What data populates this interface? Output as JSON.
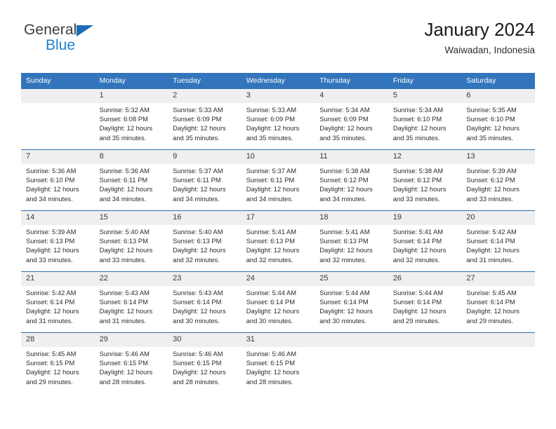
{
  "brand": {
    "name_part1": "General",
    "name_part2": "Blue",
    "triangle_icon": "brand-triangle-icon",
    "color_dark": "#3c3c3c",
    "color_blue": "#2081cf"
  },
  "header": {
    "title": "January 2024",
    "subtitle": "Waiwadan, Indonesia",
    "accent_color": "#3275bc"
  },
  "calendar": {
    "weekday_headers": [
      "Sunday",
      "Monday",
      "Tuesday",
      "Wednesday",
      "Thursday",
      "Friday",
      "Saturday"
    ],
    "header_bg": "#3275bc",
    "header_text_color": "#ffffff",
    "daynum_bg": "#efefef",
    "row_border_color": "#2f6da8",
    "labels": {
      "sunrise": "Sunrise:",
      "sunset": "Sunset:",
      "daylight": "Daylight:"
    },
    "weeks": [
      [
        {
          "day": "",
          "sunrise": "",
          "sunset": "",
          "daylight_a": "",
          "daylight_b": ""
        },
        {
          "day": "1",
          "sunrise": "Sunrise: 5:32 AM",
          "sunset": "Sunset: 6:08 PM",
          "daylight_a": "Daylight: 12 hours",
          "daylight_b": "and 35 minutes."
        },
        {
          "day": "2",
          "sunrise": "Sunrise: 5:33 AM",
          "sunset": "Sunset: 6:09 PM",
          "daylight_a": "Daylight: 12 hours",
          "daylight_b": "and 35 minutes."
        },
        {
          "day": "3",
          "sunrise": "Sunrise: 5:33 AM",
          "sunset": "Sunset: 6:09 PM",
          "daylight_a": "Daylight: 12 hours",
          "daylight_b": "and 35 minutes."
        },
        {
          "day": "4",
          "sunrise": "Sunrise: 5:34 AM",
          "sunset": "Sunset: 6:09 PM",
          "daylight_a": "Daylight: 12 hours",
          "daylight_b": "and 35 minutes."
        },
        {
          "day": "5",
          "sunrise": "Sunrise: 5:34 AM",
          "sunset": "Sunset: 6:10 PM",
          "daylight_a": "Daylight: 12 hours",
          "daylight_b": "and 35 minutes."
        },
        {
          "day": "6",
          "sunrise": "Sunrise: 5:35 AM",
          "sunset": "Sunset: 6:10 PM",
          "daylight_a": "Daylight: 12 hours",
          "daylight_b": "and 35 minutes."
        }
      ],
      [
        {
          "day": "7",
          "sunrise": "Sunrise: 5:36 AM",
          "sunset": "Sunset: 6:10 PM",
          "daylight_a": "Daylight: 12 hours",
          "daylight_b": "and 34 minutes."
        },
        {
          "day": "8",
          "sunrise": "Sunrise: 5:36 AM",
          "sunset": "Sunset: 6:11 PM",
          "daylight_a": "Daylight: 12 hours",
          "daylight_b": "and 34 minutes."
        },
        {
          "day": "9",
          "sunrise": "Sunrise: 5:37 AM",
          "sunset": "Sunset: 6:11 PM",
          "daylight_a": "Daylight: 12 hours",
          "daylight_b": "and 34 minutes."
        },
        {
          "day": "10",
          "sunrise": "Sunrise: 5:37 AM",
          "sunset": "Sunset: 6:11 PM",
          "daylight_a": "Daylight: 12 hours",
          "daylight_b": "and 34 minutes."
        },
        {
          "day": "11",
          "sunrise": "Sunrise: 5:38 AM",
          "sunset": "Sunset: 6:12 PM",
          "daylight_a": "Daylight: 12 hours",
          "daylight_b": "and 34 minutes."
        },
        {
          "day": "12",
          "sunrise": "Sunrise: 5:38 AM",
          "sunset": "Sunset: 6:12 PM",
          "daylight_a": "Daylight: 12 hours",
          "daylight_b": "and 33 minutes."
        },
        {
          "day": "13",
          "sunrise": "Sunrise: 5:39 AM",
          "sunset": "Sunset: 6:12 PM",
          "daylight_a": "Daylight: 12 hours",
          "daylight_b": "and 33 minutes."
        }
      ],
      [
        {
          "day": "14",
          "sunrise": "Sunrise: 5:39 AM",
          "sunset": "Sunset: 6:13 PM",
          "daylight_a": "Daylight: 12 hours",
          "daylight_b": "and 33 minutes."
        },
        {
          "day": "15",
          "sunrise": "Sunrise: 5:40 AM",
          "sunset": "Sunset: 6:13 PM",
          "daylight_a": "Daylight: 12 hours",
          "daylight_b": "and 33 minutes."
        },
        {
          "day": "16",
          "sunrise": "Sunrise: 5:40 AM",
          "sunset": "Sunset: 6:13 PM",
          "daylight_a": "Daylight: 12 hours",
          "daylight_b": "and 32 minutes."
        },
        {
          "day": "17",
          "sunrise": "Sunrise: 5:41 AM",
          "sunset": "Sunset: 6:13 PM",
          "daylight_a": "Daylight: 12 hours",
          "daylight_b": "and 32 minutes."
        },
        {
          "day": "18",
          "sunrise": "Sunrise: 5:41 AM",
          "sunset": "Sunset: 6:13 PM",
          "daylight_a": "Daylight: 12 hours",
          "daylight_b": "and 32 minutes."
        },
        {
          "day": "19",
          "sunrise": "Sunrise: 5:41 AM",
          "sunset": "Sunset: 6:14 PM",
          "daylight_a": "Daylight: 12 hours",
          "daylight_b": "and 32 minutes."
        },
        {
          "day": "20",
          "sunrise": "Sunrise: 5:42 AM",
          "sunset": "Sunset: 6:14 PM",
          "daylight_a": "Daylight: 12 hours",
          "daylight_b": "and 31 minutes."
        }
      ],
      [
        {
          "day": "21",
          "sunrise": "Sunrise: 5:42 AM",
          "sunset": "Sunset: 6:14 PM",
          "daylight_a": "Daylight: 12 hours",
          "daylight_b": "and 31 minutes."
        },
        {
          "day": "22",
          "sunrise": "Sunrise: 5:43 AM",
          "sunset": "Sunset: 6:14 PM",
          "daylight_a": "Daylight: 12 hours",
          "daylight_b": "and 31 minutes."
        },
        {
          "day": "23",
          "sunrise": "Sunrise: 5:43 AM",
          "sunset": "Sunset: 6:14 PM",
          "daylight_a": "Daylight: 12 hours",
          "daylight_b": "and 30 minutes."
        },
        {
          "day": "24",
          "sunrise": "Sunrise: 5:44 AM",
          "sunset": "Sunset: 6:14 PM",
          "daylight_a": "Daylight: 12 hours",
          "daylight_b": "and 30 minutes."
        },
        {
          "day": "25",
          "sunrise": "Sunrise: 5:44 AM",
          "sunset": "Sunset: 6:14 PM",
          "daylight_a": "Daylight: 12 hours",
          "daylight_b": "and 30 minutes."
        },
        {
          "day": "26",
          "sunrise": "Sunrise: 5:44 AM",
          "sunset": "Sunset: 6:14 PM",
          "daylight_a": "Daylight: 12 hours",
          "daylight_b": "and 29 minutes."
        },
        {
          "day": "27",
          "sunrise": "Sunrise: 5:45 AM",
          "sunset": "Sunset: 6:14 PM",
          "daylight_a": "Daylight: 12 hours",
          "daylight_b": "and 29 minutes."
        }
      ],
      [
        {
          "day": "28",
          "sunrise": "Sunrise: 5:45 AM",
          "sunset": "Sunset: 6:15 PM",
          "daylight_a": "Daylight: 12 hours",
          "daylight_b": "and 29 minutes."
        },
        {
          "day": "29",
          "sunrise": "Sunrise: 5:46 AM",
          "sunset": "Sunset: 6:15 PM",
          "daylight_a": "Daylight: 12 hours",
          "daylight_b": "and 28 minutes."
        },
        {
          "day": "30",
          "sunrise": "Sunrise: 5:46 AM",
          "sunset": "Sunset: 6:15 PM",
          "daylight_a": "Daylight: 12 hours",
          "daylight_b": "and 28 minutes."
        },
        {
          "day": "31",
          "sunrise": "Sunrise: 5:46 AM",
          "sunset": "Sunset: 6:15 PM",
          "daylight_a": "Daylight: 12 hours",
          "daylight_b": "and 28 minutes."
        },
        {
          "day": "",
          "sunrise": "",
          "sunset": "",
          "daylight_a": "",
          "daylight_b": ""
        },
        {
          "day": "",
          "sunrise": "",
          "sunset": "",
          "daylight_a": "",
          "daylight_b": ""
        },
        {
          "day": "",
          "sunrise": "",
          "sunset": "",
          "daylight_a": "",
          "daylight_b": ""
        }
      ]
    ]
  }
}
